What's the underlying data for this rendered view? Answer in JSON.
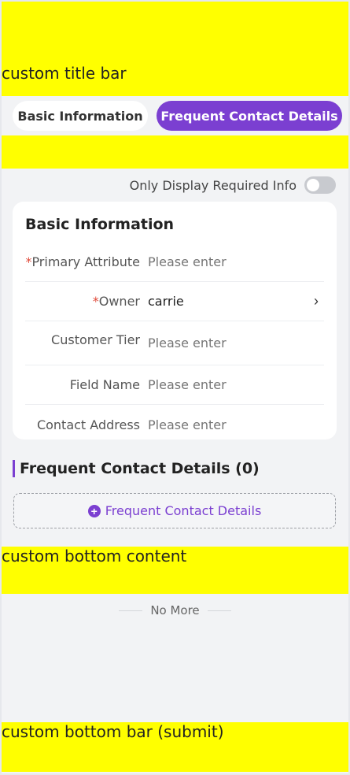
{
  "title_bar": {
    "label": "custom title bar"
  },
  "tabs": [
    {
      "label": "Basic Information",
      "active": false
    },
    {
      "label": "Frequent Contact Details",
      "active": true
    }
  ],
  "clipped_band": {
    "glimpse": ""
  },
  "toggle": {
    "label": "Only Display Required Info",
    "on": false
  },
  "basic_card": {
    "title": "Basic Information",
    "fields": [
      {
        "required": "*",
        "label": "Primary Attribute",
        "placeholder": "Please enter",
        "value": ""
      },
      {
        "required": "*",
        "label": "Owner",
        "placeholder": "",
        "value": "carrie",
        "has_chevron": true
      },
      {
        "required": "",
        "label": "Customer Tier",
        "placeholder": "Please enter",
        "value": ""
      },
      {
        "required": "",
        "label": "Field Name",
        "placeholder": "Please enter",
        "value": ""
      },
      {
        "required": "",
        "label": "Contact Address",
        "placeholder": "Please enter",
        "value": ""
      }
    ]
  },
  "contacts_section": {
    "title": "Frequent Contact Details (0)",
    "add_label": "Frequent Contact Details"
  },
  "bottom_content": {
    "label": "custom bottom content"
  },
  "no_more": {
    "label": "No More"
  },
  "bottom_bar": {
    "label": "custom bottom bar (submit)"
  },
  "colors": {
    "accent": "#7b3fd1",
    "placeholder_band": "#ffff00",
    "required": "#e04a3a"
  }
}
